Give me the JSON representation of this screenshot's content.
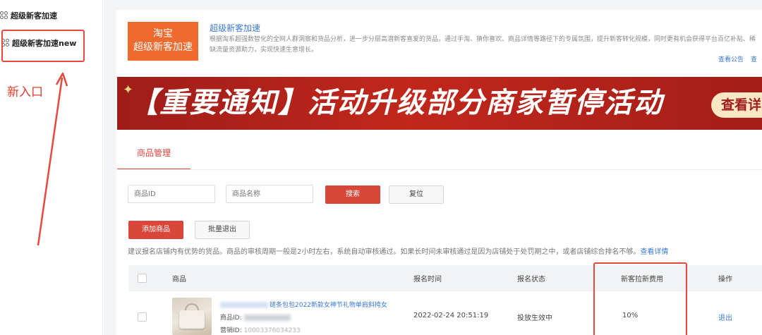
{
  "sidebar": {
    "items": [
      {
        "label": "超级新客加速"
      },
      {
        "label": "超级新客加速new"
      }
    ],
    "annotation": "新入口"
  },
  "header": {
    "logo_line1": "淘宝",
    "logo_line2": "超级新客加速",
    "title": "超级新客加速",
    "description": "根据淘系超强数智化的全网人群洞察和货品分析，进一步分层高潜新客喜爱的货品，通过手淘、猜你喜欢、商品详情等路径下的专属氛围，提升新客转化规模，同时更有机会获得平台百亿补贴、稀缺流量资源助力，实现快速生意增长。",
    "link_notice": "查看公告",
    "link_more": "查"
  },
  "banner": {
    "text": "【重要通知】活动升级部分商家暂停活动",
    "button": "查看详"
  },
  "tabs": [
    {
      "label": "商品管理"
    }
  ],
  "filters": {
    "product_id_placeholder": "商品ID",
    "product_name_placeholder": "商品名称",
    "search_label": "搜索",
    "reset_label": "复位"
  },
  "actions": {
    "add_label": "添加商品",
    "batch_exit_label": "批量退出"
  },
  "tip": {
    "text": "建议报名店铺内有优势的货品。商品的审核周期一般是2小时左右，系统自动审核通过。如果长时间未审核通过是因为店铺处于处罚期之中，或者店铺综合排名不够。",
    "link": "查看详情"
  },
  "table": {
    "columns": [
      "商品",
      "报名时间",
      "报名状态",
      "新客拉新费用",
      "操作"
    ],
    "rows": [
      {
        "title": "链条包包2022新款女神节礼物单肩斜挎女",
        "id_label": "商品ID:",
        "sales_label": "营销ID:",
        "sales_value": "10003376034233",
        "time": "2022-02-24 20:51:19",
        "status": "投放生效中",
        "fee": "10%",
        "action": "退出"
      }
    ]
  },
  "colors": {
    "accent": "#d9473b",
    "annotation_red": "#e8473b",
    "link": "#3a7ad8",
    "logo": "#ef6a2c"
  }
}
